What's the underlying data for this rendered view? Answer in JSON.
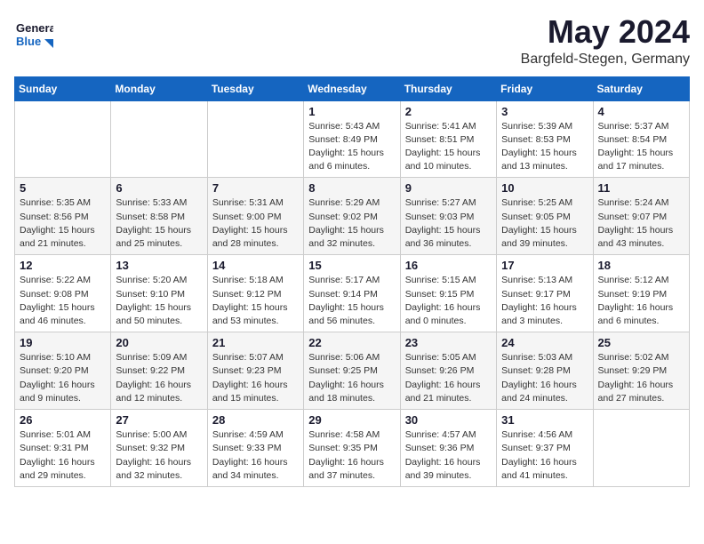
{
  "header": {
    "logo_general": "General",
    "logo_blue": "Blue",
    "month": "May 2024",
    "location": "Bargfeld-Stegen, Germany"
  },
  "days_of_week": [
    "Sunday",
    "Monday",
    "Tuesday",
    "Wednesday",
    "Thursday",
    "Friday",
    "Saturday"
  ],
  "weeks": [
    [
      {
        "day": "",
        "info": ""
      },
      {
        "day": "",
        "info": ""
      },
      {
        "day": "",
        "info": ""
      },
      {
        "day": "1",
        "info": "Sunrise: 5:43 AM\nSunset: 8:49 PM\nDaylight: 15 hours\nand 6 minutes."
      },
      {
        "day": "2",
        "info": "Sunrise: 5:41 AM\nSunset: 8:51 PM\nDaylight: 15 hours\nand 10 minutes."
      },
      {
        "day": "3",
        "info": "Sunrise: 5:39 AM\nSunset: 8:53 PM\nDaylight: 15 hours\nand 13 minutes."
      },
      {
        "day": "4",
        "info": "Sunrise: 5:37 AM\nSunset: 8:54 PM\nDaylight: 15 hours\nand 17 minutes."
      }
    ],
    [
      {
        "day": "5",
        "info": "Sunrise: 5:35 AM\nSunset: 8:56 PM\nDaylight: 15 hours\nand 21 minutes."
      },
      {
        "day": "6",
        "info": "Sunrise: 5:33 AM\nSunset: 8:58 PM\nDaylight: 15 hours\nand 25 minutes."
      },
      {
        "day": "7",
        "info": "Sunrise: 5:31 AM\nSunset: 9:00 PM\nDaylight: 15 hours\nand 28 minutes."
      },
      {
        "day": "8",
        "info": "Sunrise: 5:29 AM\nSunset: 9:02 PM\nDaylight: 15 hours\nand 32 minutes."
      },
      {
        "day": "9",
        "info": "Sunrise: 5:27 AM\nSunset: 9:03 PM\nDaylight: 15 hours\nand 36 minutes."
      },
      {
        "day": "10",
        "info": "Sunrise: 5:25 AM\nSunset: 9:05 PM\nDaylight: 15 hours\nand 39 minutes."
      },
      {
        "day": "11",
        "info": "Sunrise: 5:24 AM\nSunset: 9:07 PM\nDaylight: 15 hours\nand 43 minutes."
      }
    ],
    [
      {
        "day": "12",
        "info": "Sunrise: 5:22 AM\nSunset: 9:08 PM\nDaylight: 15 hours\nand 46 minutes."
      },
      {
        "day": "13",
        "info": "Sunrise: 5:20 AM\nSunset: 9:10 PM\nDaylight: 15 hours\nand 50 minutes."
      },
      {
        "day": "14",
        "info": "Sunrise: 5:18 AM\nSunset: 9:12 PM\nDaylight: 15 hours\nand 53 minutes."
      },
      {
        "day": "15",
        "info": "Sunrise: 5:17 AM\nSunset: 9:14 PM\nDaylight: 15 hours\nand 56 minutes."
      },
      {
        "day": "16",
        "info": "Sunrise: 5:15 AM\nSunset: 9:15 PM\nDaylight: 16 hours\nand 0 minutes."
      },
      {
        "day": "17",
        "info": "Sunrise: 5:13 AM\nSunset: 9:17 PM\nDaylight: 16 hours\nand 3 minutes."
      },
      {
        "day": "18",
        "info": "Sunrise: 5:12 AM\nSunset: 9:19 PM\nDaylight: 16 hours\nand 6 minutes."
      }
    ],
    [
      {
        "day": "19",
        "info": "Sunrise: 5:10 AM\nSunset: 9:20 PM\nDaylight: 16 hours\nand 9 minutes."
      },
      {
        "day": "20",
        "info": "Sunrise: 5:09 AM\nSunset: 9:22 PM\nDaylight: 16 hours\nand 12 minutes."
      },
      {
        "day": "21",
        "info": "Sunrise: 5:07 AM\nSunset: 9:23 PM\nDaylight: 16 hours\nand 15 minutes."
      },
      {
        "day": "22",
        "info": "Sunrise: 5:06 AM\nSunset: 9:25 PM\nDaylight: 16 hours\nand 18 minutes."
      },
      {
        "day": "23",
        "info": "Sunrise: 5:05 AM\nSunset: 9:26 PM\nDaylight: 16 hours\nand 21 minutes."
      },
      {
        "day": "24",
        "info": "Sunrise: 5:03 AM\nSunset: 9:28 PM\nDaylight: 16 hours\nand 24 minutes."
      },
      {
        "day": "25",
        "info": "Sunrise: 5:02 AM\nSunset: 9:29 PM\nDaylight: 16 hours\nand 27 minutes."
      }
    ],
    [
      {
        "day": "26",
        "info": "Sunrise: 5:01 AM\nSunset: 9:31 PM\nDaylight: 16 hours\nand 29 minutes."
      },
      {
        "day": "27",
        "info": "Sunrise: 5:00 AM\nSunset: 9:32 PM\nDaylight: 16 hours\nand 32 minutes."
      },
      {
        "day": "28",
        "info": "Sunrise: 4:59 AM\nSunset: 9:33 PM\nDaylight: 16 hours\nand 34 minutes."
      },
      {
        "day": "29",
        "info": "Sunrise: 4:58 AM\nSunset: 9:35 PM\nDaylight: 16 hours\nand 37 minutes."
      },
      {
        "day": "30",
        "info": "Sunrise: 4:57 AM\nSunset: 9:36 PM\nDaylight: 16 hours\nand 39 minutes."
      },
      {
        "day": "31",
        "info": "Sunrise: 4:56 AM\nSunset: 9:37 PM\nDaylight: 16 hours\nand 41 minutes."
      },
      {
        "day": "",
        "info": ""
      }
    ]
  ]
}
